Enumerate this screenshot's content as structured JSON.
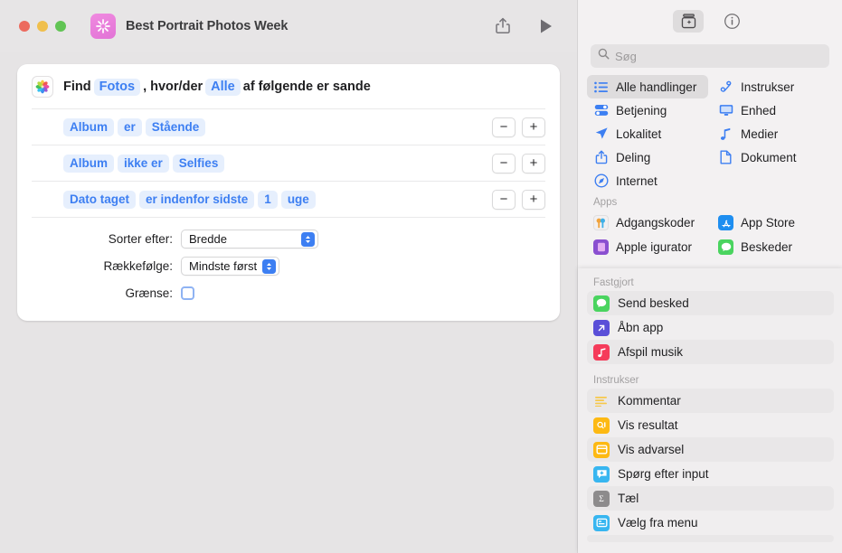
{
  "window": {
    "title": "Best Portrait Photos Week",
    "app_icon": "shortcuts-icon",
    "traffic_lights": [
      "close-red",
      "minimize-yellow",
      "zoom-green"
    ],
    "colors": {
      "red": "#ec6a5e",
      "yellow": "#f0bf4c",
      "green": "#61c454",
      "accent_blue": "#3d7ff2"
    },
    "toolbar": {
      "share_label": "share-icon",
      "run_label": "run-icon"
    }
  },
  "action_card": {
    "app_icon": "photos-icon",
    "find_prefix": "Find",
    "find_source": "Fotos",
    "find_middle": ", hvor/der",
    "find_match": "Alle",
    "find_suffix": "af følgende er sande",
    "conditions": [
      {
        "field": "Album",
        "operator": "er",
        "value": "Stående"
      },
      {
        "field": "Album",
        "operator": "ikke er",
        "value": "Selfies"
      },
      {
        "field": "Dato taget",
        "operator": "er indenfor sidste",
        "value": "1",
        "unit": "uge"
      }
    ],
    "row_buttons": {
      "remove": "−",
      "add": "+"
    },
    "params": [
      {
        "label": "Sorter efter:",
        "value": "Bredde",
        "type": "popup"
      },
      {
        "label": "Rækkefølge:",
        "value": "Mindste først",
        "type": "popup"
      },
      {
        "label": "Grænse:",
        "value": "",
        "type": "checkbox",
        "checked": false
      }
    ]
  },
  "sidebar": {
    "toolbar": [
      {
        "name": "action-library-icon",
        "selected": true
      },
      {
        "name": "info-icon",
        "selected": false
      }
    ],
    "search": {
      "placeholder": "Søg",
      "value": "",
      "icon": "search-icon"
    },
    "categories": [
      {
        "label": "Alle handlinger",
        "icon": "list-icon",
        "selected": true
      },
      {
        "label": "Instrukser",
        "icon": "script-icon",
        "selected": false
      },
      {
        "label": "Betjening",
        "icon": "controls-icon",
        "selected": false
      },
      {
        "label": "Enhed",
        "icon": "display-icon",
        "selected": false
      },
      {
        "label": "Lokalitet",
        "icon": "location-arrow-icon",
        "selected": false
      },
      {
        "label": "Medier",
        "icon": "music-note-icon",
        "selected": false
      },
      {
        "label": "Deling",
        "icon": "share-icon",
        "selected": false
      },
      {
        "label": "Dokument",
        "icon": "document-icon",
        "selected": false
      },
      {
        "label": "Internet",
        "icon": "safari-compass-icon",
        "selected": false
      }
    ],
    "apps_header": "Apps",
    "apps": [
      {
        "label": "Adgangskoder",
        "icon": "passwords-icon",
        "color": "#f5f5f5"
      },
      {
        "label": "App Store",
        "icon": "app-store-icon",
        "color": "#1e8ef0"
      },
      {
        "label": "Apple  igurator",
        "icon": "apple-configurator-icon",
        "color": "#8a4fd0"
      },
      {
        "label": "Beskeder",
        "icon": "messages-icon",
        "color": "#4ad45f"
      }
    ],
    "pinned_header": "Fastgjort",
    "pinned": [
      {
        "label": "Send besked",
        "icon": "messages-icon",
        "color": "#4ad45f"
      },
      {
        "label": "Åbn app",
        "icon": "open-app-icon",
        "color": "#5a4fd8"
      },
      {
        "label": "Afspil musik",
        "icon": "music-icon",
        "color": "#f53b5a"
      }
    ],
    "scripting_header": "Instrukser",
    "scripting": [
      {
        "label": "Kommentar",
        "icon": "comment-lines-icon",
        "color": "#ffffff"
      },
      {
        "label": "Vis resultat",
        "icon": "show-result-icon",
        "color": "#fdb913"
      },
      {
        "label": "Vis advarsel",
        "icon": "show-alert-icon",
        "color": "#fdb913"
      },
      {
        "label": "Spørg efter input",
        "icon": "ask-input-icon",
        "color": "#38b6f0"
      },
      {
        "label": "Tæl",
        "icon": "count-sigma-icon",
        "color": "#8d8b8c"
      },
      {
        "label": "Vælg fra menu",
        "icon": "choose-menu-icon",
        "color": "#38b6f0"
      }
    ]
  }
}
